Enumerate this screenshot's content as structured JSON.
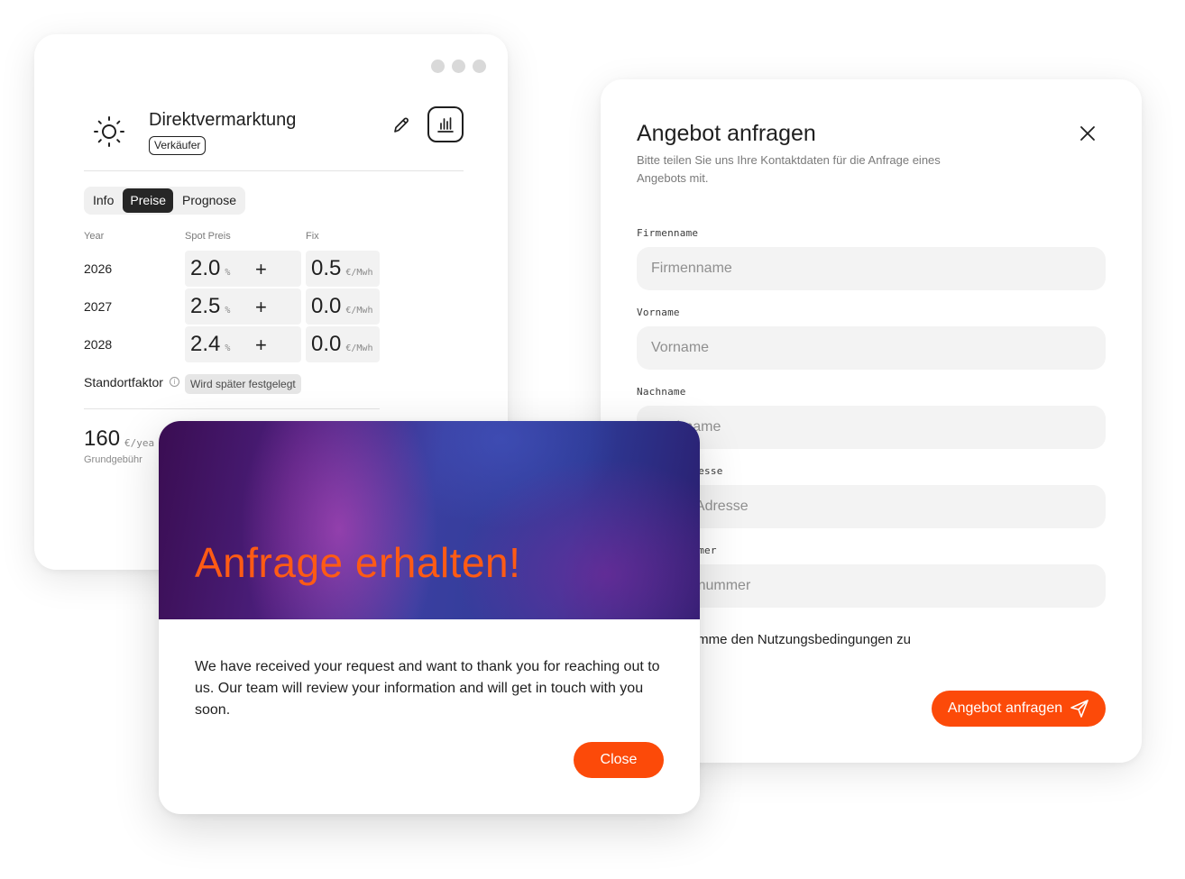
{
  "product_card": {
    "title": "Direktvermarktung",
    "role_badge": "Verkäufer",
    "icons": {
      "main": "sun-icon",
      "edit": "pencil-icon",
      "chart": "bar-chart-icon"
    },
    "tabs": [
      {
        "label": "Info",
        "active": false
      },
      {
        "label": "Preise",
        "active": true
      },
      {
        "label": "Prognose",
        "active": false
      }
    ],
    "columns": {
      "year": "Year",
      "spot": "Spot Preis",
      "fix": "Fix"
    },
    "rows": [
      {
        "year": "2026",
        "spot": "2.0",
        "spot_unit": "%",
        "plus": "+",
        "fix": "0.5",
        "fix_unit": "€/Mwh"
      },
      {
        "year": "2027",
        "spot": "2.5",
        "spot_unit": "%",
        "plus": "+",
        "fix": "0.0",
        "fix_unit": "€/Mwh"
      },
      {
        "year": "2028",
        "spot": "2.4",
        "spot_unit": "%",
        "plus": "+",
        "fix": "0.0",
        "fix_unit": "€/Mwh"
      }
    ],
    "standortfaktor": {
      "label": "Standortfaktor",
      "info_glyph": "i",
      "value": "Wird später festgelegt"
    },
    "fee": {
      "value": "160",
      "unit": "€/yea",
      "label": "Grundgebühr"
    }
  },
  "form": {
    "title": "Angebot anfragen",
    "subtitle": "Bitte teilen Sie uns Ihre Kontaktdaten für die Anfrage eines Angebots mit.",
    "fields": [
      {
        "label": "Firmenname",
        "placeholder": "Firmenname"
      },
      {
        "label": "Vorname",
        "placeholder": "Vorname"
      },
      {
        "label": "Nachname",
        "placeholder": "Nachname"
      },
      {
        "label": "E-Mail Adresse",
        "placeholder": "E-Mail Adresse"
      },
      {
        "label": "Telefonnummer",
        "placeholder": "Telefonnummer"
      }
    ],
    "terms": "Ich stimme den Nutzungsbedingungen zu",
    "submit_label": "Angebot anfragen"
  },
  "modal": {
    "title": "Anfrage erhalten!",
    "body": "We have received your request and want to thank you for reaching out to us. Our team will review your information and will get in touch with you soon.",
    "close_label": "Close"
  },
  "colors": {
    "accent": "#fc4a09",
    "dark": "#262626",
    "field_bg": "#f3f3f3"
  }
}
